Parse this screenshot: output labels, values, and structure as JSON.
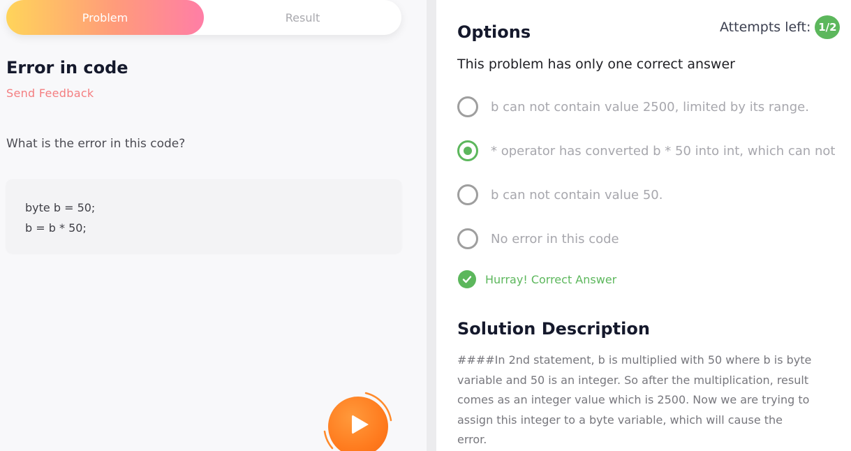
{
  "tabs": {
    "problem": "Problem",
    "result": "Result"
  },
  "problem": {
    "title": "Error in code",
    "send_feedback": "Send Feedback",
    "question": "What is the error in this code?",
    "code_lines": [
      "byte b = 50;",
      "b = b * 50;"
    ]
  },
  "options_panel": {
    "title": "Options",
    "attempts_label": "Attempts left:",
    "attempts_value": "1/2",
    "instruction": "This problem has only one correct answer",
    "options": [
      {
        "label": "b can not contain value 2500, limited by its range.",
        "selected": false
      },
      {
        "label": "* operator has converted b * 50 into int, which can not",
        "selected": true
      },
      {
        "label": "b can not contain value 50.",
        "selected": false
      },
      {
        "label": "No error in this code",
        "selected": false
      }
    ],
    "feedback": "Hurray! Correct Answer"
  },
  "solution": {
    "title": "Solution Description",
    "text": "####In 2nd statement, b is multiplied with 50 where b is byte variable and 50 is an integer. So after the multiplication, result comes as an integer value which is 2500. Now we are trying to assign this integer to a byte variable, which will cause the error."
  },
  "colors": {
    "accent_green": "#5cb75c",
    "feedback_link": "#f47e80",
    "play_orange": "#ff7b1e"
  },
  "icons": {
    "play": "play-icon",
    "check": "check-circle-icon"
  }
}
